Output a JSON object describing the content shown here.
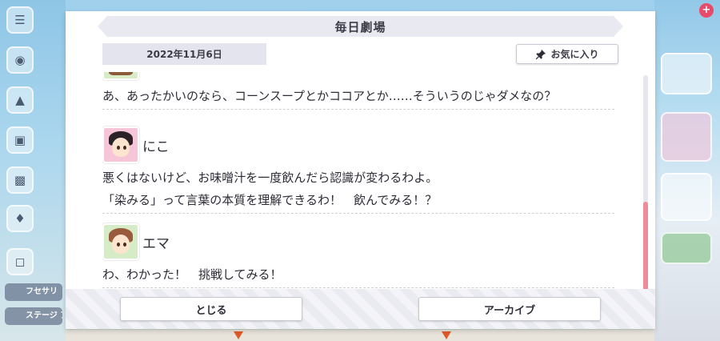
{
  "dialog": {
    "title": "毎日劇場",
    "date": "2022年11月6日",
    "favorite_label": "お気に入り"
  },
  "messages": [
    {
      "speaker": "",
      "lines": [
        "あ、あったかいのなら、コーンスープとかココアとか……そういうのじゃダメなの？"
      ]
    },
    {
      "speaker": "にこ",
      "lines": [
        "悪くはないけど、お味噌汁を一度飲んだら認識が変わるわよ。",
        "「染みる」って言葉の本質を理解できるわ！　飲んでみる！？"
      ]
    },
    {
      "speaker": "エマ",
      "lines": [
        "わ、わかった！　挑戦してみる！"
      ]
    }
  ],
  "footer": {
    "close_label": "とじる",
    "archive_label": "アーカイブ"
  },
  "background": {
    "left_labels": [
      "フセサリ",
      "ステージ アイテム"
    ]
  },
  "scroll": {
    "position_fraction": 0.62
  },
  "colors": {
    "scroll_thumb": "#ee8c9a",
    "header_bg": "#e9e9f1"
  }
}
